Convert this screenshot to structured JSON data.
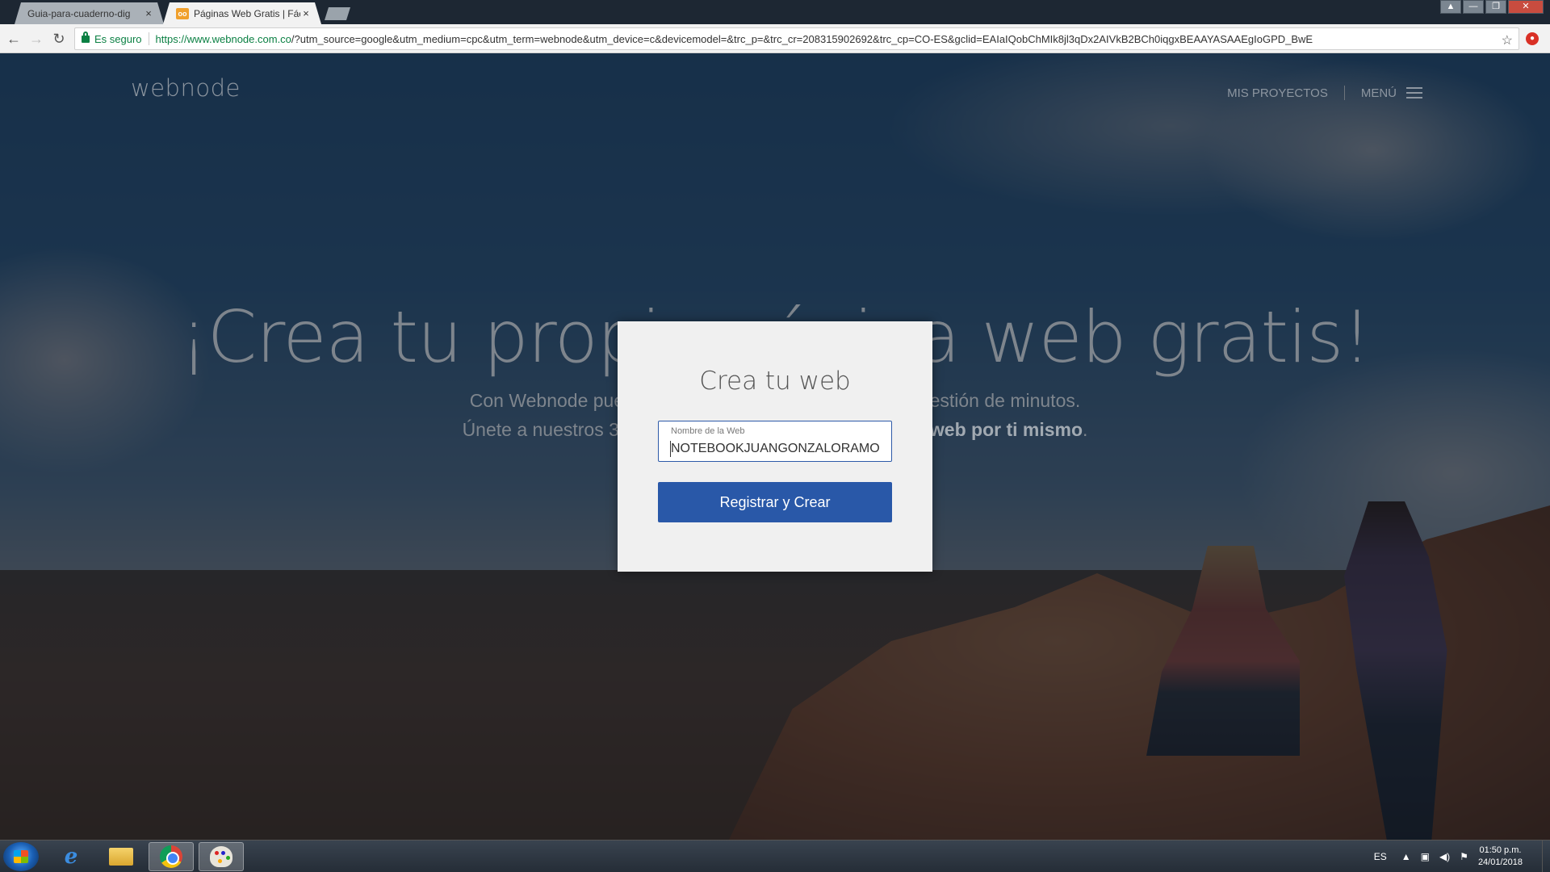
{
  "browser": {
    "tabs": [
      {
        "label": "Guia-para-cuaderno-dig",
        "active": false
      },
      {
        "label": "Páginas Web Gratis | Fác",
        "active": true
      }
    ],
    "favicon_text": "oo",
    "tab_close": "×",
    "secure_label": "Es seguro",
    "url_domain": "https://www.webnode.com.co",
    "url_rest": "/?utm_source=google&utm_medium=cpc&utm_term=webnode&utm_device=c&devicemodel=&trc_p=&trc_cr=208315902692&trc_cp=CO-ES&gclid=EAIaIQobChMIk8jl3qDx2AIVkB2BCh0iqgxBEAAYASAAEgIoGPD_BwE",
    "back_icon": "←",
    "forward_icon": "→",
    "reload_icon": "↻",
    "star_icon": "☆"
  },
  "site": {
    "logo": "webnode",
    "nav": {
      "projects": "MIS PROYECTOS",
      "menu": "MENÚ"
    },
    "hero_title": "¡Crea tu propia página web gratis!",
    "hero_line1": "Con Webnode puedes crear tu propia página web en cuestión de minutos.",
    "hero_line2_prefix": "Únete a nuestros 3",
    "hero_line2_bold": "web por ti mismo",
    "hero_line2_suffix": "."
  },
  "modal": {
    "title": "Crea tu web",
    "field_label": "Nombre de la Web",
    "field_value": "NOTEBOOKJUANGONZALORAMO",
    "submit_label": "Registrar y Crear"
  },
  "taskbar": {
    "lang": "ES",
    "time": "01:50 p.m.",
    "date": "24/01/2018"
  },
  "colors": {
    "accent": "#2958a8",
    "secure_green": "#0b8043"
  }
}
